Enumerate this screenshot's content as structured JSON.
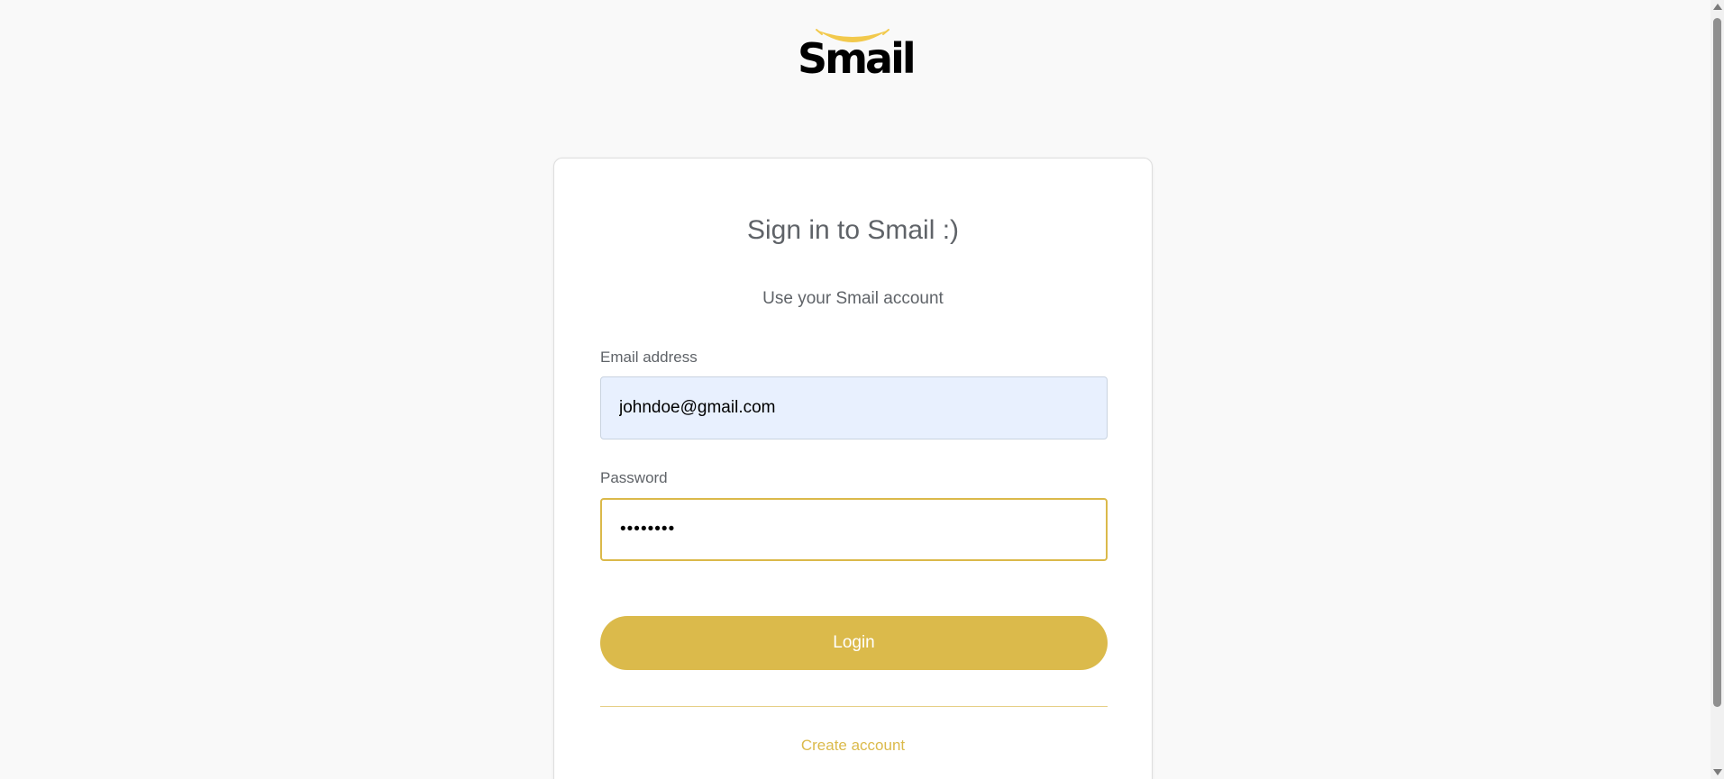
{
  "logo": {
    "text": "Smail",
    "smile_color": "#f2c94c"
  },
  "card": {
    "title": "Sign in to Smail :)",
    "subtitle": "Use your Smail account"
  },
  "form": {
    "email_label": "Email address",
    "email_value": "johndoe@gmail.com",
    "password_label": "Password",
    "password_value": "••••••••",
    "login_label": "Login",
    "create_account_label": "Create account"
  },
  "colors": {
    "accent": "#dbba4b",
    "background": "#f9f9f9",
    "email_field_bg": "#e8f0fe"
  }
}
